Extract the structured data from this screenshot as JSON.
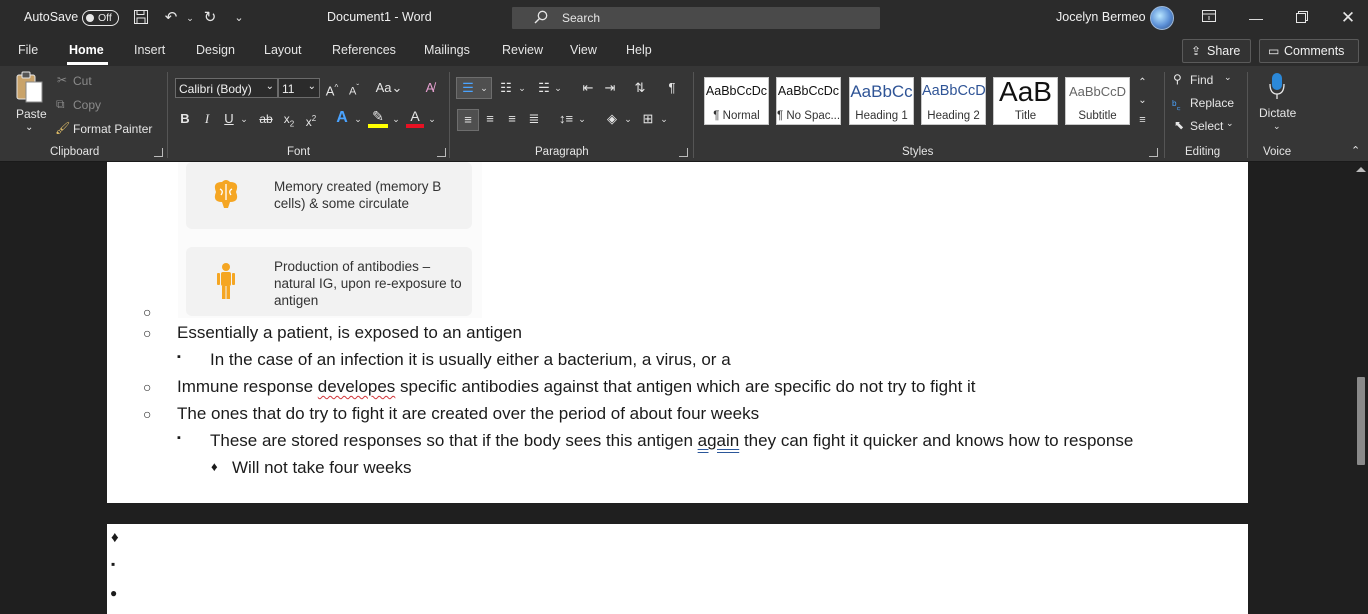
{
  "title_bar": {
    "autosave_label": "AutoSave",
    "autosave_state": "Off",
    "document_title": "Document1  -  Word",
    "search_placeholder": "Search",
    "user_name": "Jocelyn Bermeo"
  },
  "tabs": [
    "File",
    "Home",
    "Insert",
    "Design",
    "Layout",
    "References",
    "Mailings",
    "Review",
    "View",
    "Help"
  ],
  "active_tab": "Home",
  "share_label": "Share",
  "comments_label": "Comments",
  "clipboard": {
    "paste_label": "Paste",
    "cut_label": "Cut",
    "copy_label": "Copy",
    "format_painter_label": "Format Painter",
    "group_label": "Clipboard"
  },
  "font": {
    "font_name": "Calibri (Body)",
    "font_size": "11",
    "group_label": "Font"
  },
  "paragraph": {
    "group_label": "Paragraph"
  },
  "styles": {
    "group_label": "Styles",
    "items": [
      {
        "sample": "AaBbCcDc",
        "name": "¶ Normal"
      },
      {
        "sample": "AaBbCcDc",
        "name": "¶ No Spac..."
      },
      {
        "sample": "AaBbCc",
        "name": "Heading 1"
      },
      {
        "sample": "AaBbCcD",
        "name": "Heading 2"
      },
      {
        "sample": "AaB",
        "name": "Title"
      },
      {
        "sample": "AaBbCcD",
        "name": "Subtitle"
      }
    ]
  },
  "editing": {
    "find_label": "Find",
    "replace_label": "Replace",
    "select_label": "Select",
    "group_label": "Editing"
  },
  "voice": {
    "dictate_label": "Dictate",
    "group_label": "Voice"
  },
  "document": {
    "cards": [
      {
        "text": "Memory created (memory B cells) & some circulate"
      },
      {
        "text": "Production of antibodies – natural IG, upon re-exposure to antigen"
      }
    ],
    "lines": [
      {
        "bullet": "○",
        "text": ""
      },
      {
        "bullet": "○",
        "text": "Essentially a patient, is exposed to an antigen"
      },
      {
        "bullet": "▪",
        "text": "In the case of an infection it is usually either a bacterium, a virus, or a"
      },
      {
        "bullet": "○",
        "pre": "Immune response ",
        "flag": "developes",
        "post": " specific antibodies against that antigen which are specific do not try to fight it"
      },
      {
        "bullet": "○",
        "text": "The ones that do try to fight it are created over the period of about four weeks"
      },
      {
        "bullet": "▪",
        "pre": "These are stored responses so that if the body sees this antigen ",
        "flag": "again",
        "post": " they can fight it quicker and knows how to response"
      },
      {
        "bullet": "♦",
        "text": "Will not take four weeks"
      }
    ],
    "page2_bullets": [
      "♦",
      "▪",
      "●"
    ]
  },
  "colors": {
    "accent_underline": "#d13438",
    "highlight_yellow": "#ffff00",
    "font_color_red": "#e81123",
    "dictate_blue": "#2b88d8",
    "card_icon_orange": "#f5a623"
  }
}
